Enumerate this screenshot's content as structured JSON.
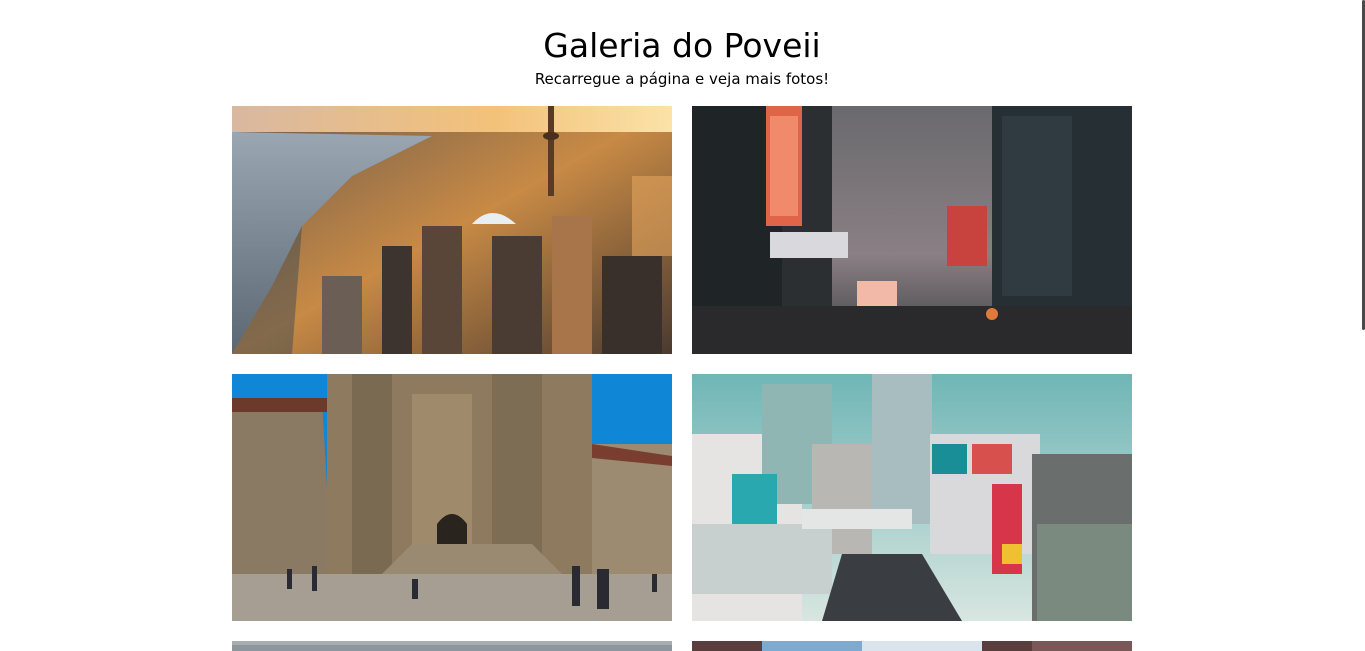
{
  "page": {
    "title": "Galeria do Poveii",
    "subtitle": "Recarregue a página e veja mais fotos!"
  },
  "gallery": {
    "photos": [
      {
        "subject": "aerial-city-sunset-photo"
      },
      {
        "subject": "foggy-night-street-photo"
      },
      {
        "subject": "cathedral-plaza-photo"
      },
      {
        "subject": "busy-city-crossing-photo"
      },
      {
        "subject": "cloudy-sky-photo"
      },
      {
        "subject": "city-buildings-photo"
      }
    ]
  },
  "colors": {
    "background": "#ffffff",
    "text": "#000000",
    "scrollbar_thumb": "#4a4a4a"
  }
}
